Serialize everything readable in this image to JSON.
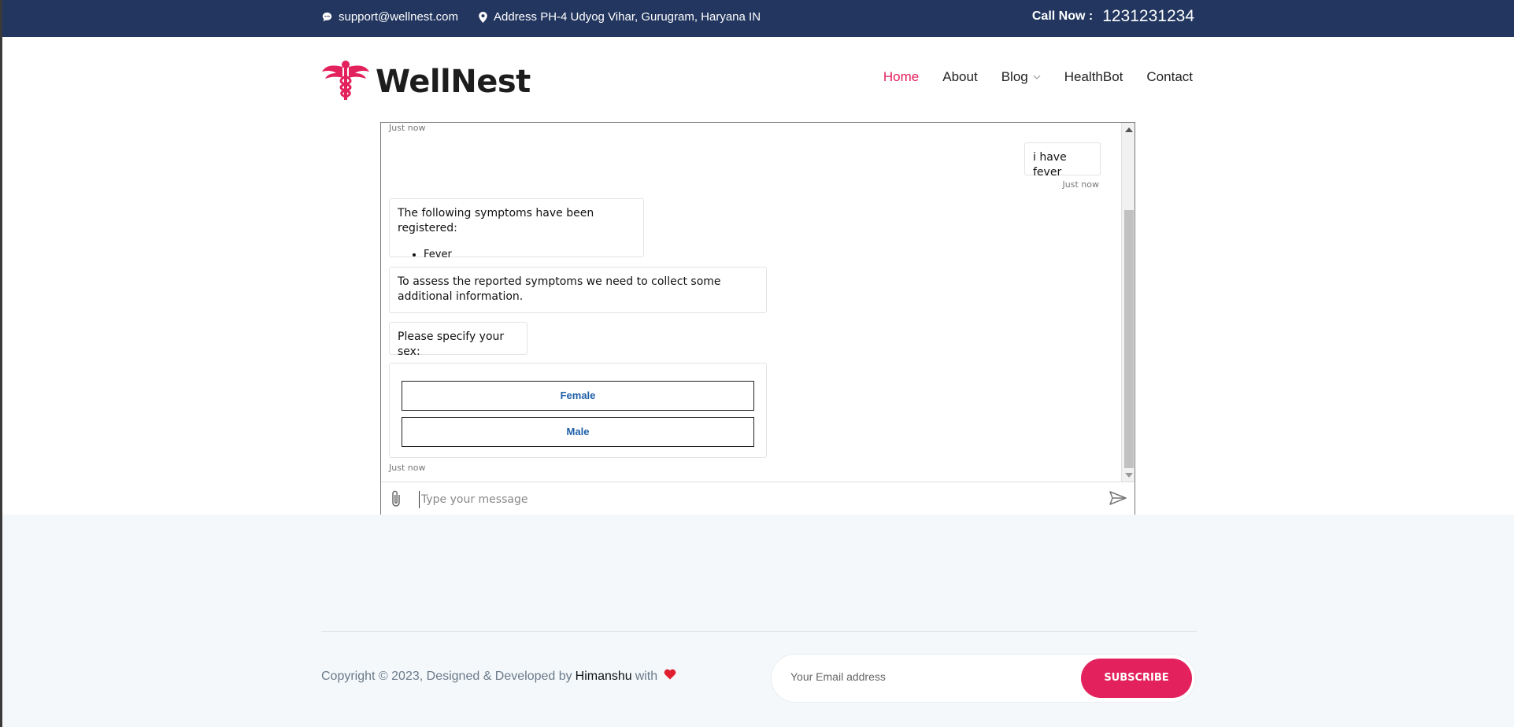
{
  "topbar": {
    "email": "support@wellnest.com",
    "address": "Address PH-4 Udyog Vihar, Gurugram, Haryana IN",
    "call_label": "Call Now :",
    "call_number": "1231231234",
    "email_icon": "chat-bubble-icon",
    "address_icon": "map-pin-icon",
    "bg_color": "#22365f"
  },
  "header": {
    "brand": "WellNest",
    "logo_icon": "caduceus-icon",
    "nav": [
      {
        "label": "Home",
        "active": true
      },
      {
        "label": "About"
      },
      {
        "label": "Blog"
      },
      {
        "label": "HealthBot"
      },
      {
        "label": "Contact"
      }
    ],
    "accent_color": "#e3215c"
  },
  "chat": {
    "ts_top": "Just now",
    "user_message": "i have fever",
    "ts_user": "Just now",
    "bot_symptoms_intro": "The following symptoms have been registered:",
    "bot_symptoms": [
      "Fever"
    ],
    "bot_assess": "To assess the reported symptoms we need to collect some additional information.",
    "bot_question": "Please specify your sex:",
    "options": [
      "Female",
      "Male"
    ],
    "ts_bot": "Just now",
    "input_placeholder": "Type your message",
    "attach_icon": "paperclip-icon",
    "send_icon": "send-icon"
  },
  "footer": {
    "copyright_prefix": "Copyright © 2023, Designed & Developed by",
    "author": "Himanshu",
    "copyright_suffix": "with",
    "heart_icon": "heart-icon",
    "email_placeholder": "Your Email address",
    "subscribe_label": "SUBSCRIBE"
  }
}
